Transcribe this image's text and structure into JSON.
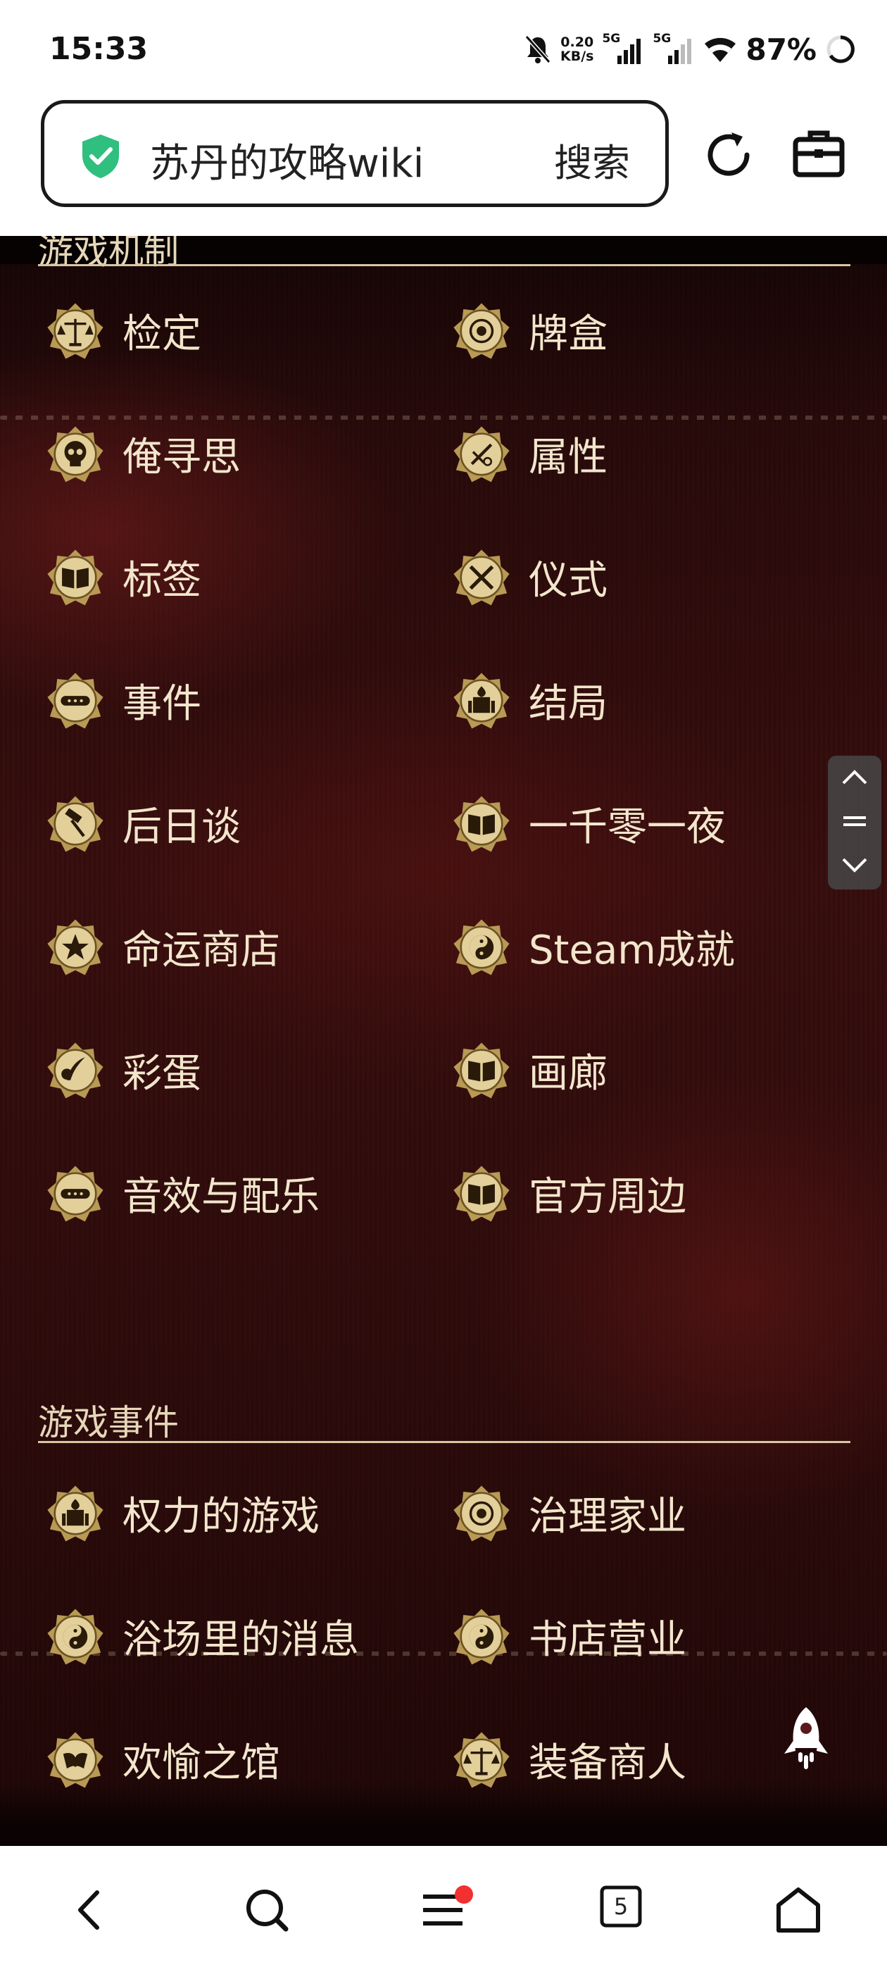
{
  "status_bar": {
    "time": "15:33",
    "net_speed_value": "0.20",
    "net_speed_unit": "KB/s",
    "sim1_label": "5G",
    "sim2_label": "5G",
    "battery_percent": "87%",
    "icons": [
      "bell-off-icon",
      "signal-icon",
      "signal-icon",
      "wifi-icon",
      "battery-ring-icon"
    ]
  },
  "toolbar": {
    "site_title": "苏丹的攻略wiki",
    "search_label": "搜索",
    "icons": [
      "shield-check-icon",
      "reload-icon",
      "toolbox-icon"
    ]
  },
  "sections": [
    {
      "title": "游戏机制",
      "items": [
        {
          "label": "检定",
          "icon": "scales-icon"
        },
        {
          "label": "牌盒",
          "icon": "seal-icon"
        },
        {
          "label": "俺寻思",
          "icon": "skull-icon"
        },
        {
          "label": "属性",
          "icon": "sword-icon"
        },
        {
          "label": "标签",
          "icon": "book-icon"
        },
        {
          "label": "仪式",
          "icon": "crossed-swords-icon"
        },
        {
          "label": "事件",
          "icon": "scroll-icon"
        },
        {
          "label": "结局",
          "icon": "palace-icon"
        },
        {
          "label": "后日谈",
          "icon": "hammer-icon"
        },
        {
          "label": "一千零一夜",
          "icon": "book-icon"
        },
        {
          "label": "命运商店",
          "icon": "star-icon"
        },
        {
          "label": "Steam成就",
          "icon": "yin-yang-icon"
        },
        {
          "label": "彩蛋",
          "icon": "quill-icon"
        },
        {
          "label": "画廊",
          "icon": "book-icon"
        },
        {
          "label": "音效与配乐",
          "icon": "scroll-icon"
        },
        {
          "label": "官方周边",
          "icon": "book-icon"
        }
      ]
    },
    {
      "title": "游戏事件",
      "items": [
        {
          "label": "权力的游戏",
          "icon": "palace-icon"
        },
        {
          "label": "治理家业",
          "icon": "seal-icon"
        },
        {
          "label": "浴场里的消息",
          "icon": "yin-yang-icon"
        },
        {
          "label": "书店营业",
          "icon": "yin-yang-icon"
        },
        {
          "label": "欢愉之馆",
          "icon": "mask-icon"
        },
        {
          "label": "装备商人",
          "icon": "scales-icon"
        }
      ]
    }
  ],
  "floating": {
    "icons": [
      "chevron-up-icon",
      "menu-lines-icon",
      "chevron-down-icon",
      "rocket-icon"
    ]
  },
  "bottom_nav": {
    "tab_count": "5",
    "icons": [
      "back-icon",
      "search-icon",
      "menu-icon",
      "tabs-icon",
      "home-icon"
    ]
  },
  "colors": {
    "accent_green": "#2fbf7f",
    "gold": "#d8c7a3",
    "page_text": "#f2e6cc",
    "notification_red": "#f23030"
  }
}
